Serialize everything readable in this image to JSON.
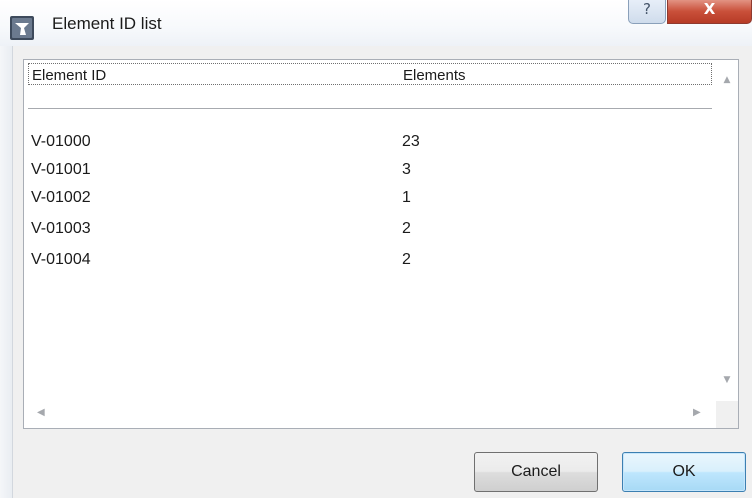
{
  "window": {
    "title": "Element ID list",
    "help_glyph": "?",
    "close_glyph": "X"
  },
  "table": {
    "columns": [
      "Element ID",
      "Elements"
    ],
    "rows": [
      {
        "id": "V-01000",
        "elements": "23"
      },
      {
        "id": "V-01001",
        "elements": "3"
      },
      {
        "id": "V-01002",
        "elements": "1"
      },
      {
        "id": "V-01003",
        "elements": "2"
      },
      {
        "id": "V-01004",
        "elements": "2"
      }
    ]
  },
  "buttons": {
    "cancel": "Cancel",
    "ok": "OK"
  },
  "icons": {
    "app": "app-window-icon",
    "help": "help-icon",
    "close": "close-icon",
    "scroll_up": "scroll-up-arrow-icon",
    "scroll_down": "scroll-down-arrow-icon",
    "scroll_left": "scroll-left-arrow-icon",
    "scroll_right": "scroll-right-arrow-icon"
  },
  "colors": {
    "close_button": "#c9503a",
    "ok_button_border": "#3c7fb1"
  }
}
